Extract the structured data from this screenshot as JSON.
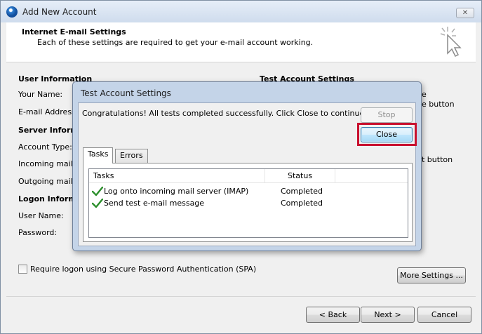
{
  "window": {
    "title": "Add New Account",
    "close_glyph": "✕"
  },
  "header": {
    "title": "Internet E-mail Settings",
    "subtitle": "Each of these settings are required to get your e-mail account working."
  },
  "background_form": {
    "user_info_title": "User Information",
    "your_name_label": "Your Name:",
    "email_label": "E-mail Address:",
    "server_info_title": "Server Inform",
    "account_type_label": "Account Type:",
    "incoming_label": "Incoming mail se",
    "outgoing_label": "Outgoing mail se",
    "logon_info_title": "Logon Inform",
    "user_name_label": "User Name:",
    "password_label": "Password:",
    "test_settings_title": "Test Account Settings",
    "right_fragment_1": "e",
    "right_fragment_2": "e button",
    "right_fragment_3": "t button",
    "spa_label": "Require logon using Secure Password Authentication (SPA)",
    "more_settings_label": "More Settings ..."
  },
  "footer": {
    "back_label": "< Back",
    "next_label": "Next >",
    "cancel_label": "Cancel"
  },
  "dialog": {
    "title": "Test Account Settings",
    "message": "Congratulations! All tests completed successfully. Click Close to continue.",
    "stop_label": "Stop",
    "close_label": "Close",
    "tabs": [
      {
        "label": "Tasks",
        "active": true
      },
      {
        "label": "Errors",
        "active": false
      }
    ],
    "columns": {
      "task": "Tasks",
      "status": "Status"
    },
    "rows": [
      {
        "task": "Log onto incoming mail server (IMAP)",
        "status": "Completed"
      },
      {
        "task": "Send test e-mail message",
        "status": "Completed"
      }
    ]
  },
  "colors": {
    "highlight": "#c8102e",
    "check_green": "#2c8f2c",
    "close_button": "#bee6fd"
  },
  "icons": {
    "app": "outlook-globe-icon",
    "header": "cursor-click-icon",
    "row_status": "checkmark-icon"
  }
}
